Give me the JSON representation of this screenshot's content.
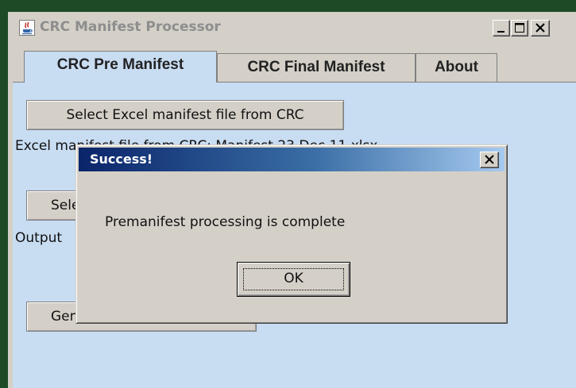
{
  "window": {
    "title": "CRC Manifest Processor",
    "controls": [
      "minimize-icon",
      "maximize-icon",
      "close-icon"
    ]
  },
  "tabs": [
    {
      "label": "CRC Pre Manifest",
      "selected": true
    },
    {
      "label": "CRC Final Manifest",
      "selected": false
    },
    {
      "label": "About",
      "selected": false
    }
  ],
  "panel": {
    "select_excel_label": "Select Excel manifest file from CRC",
    "excel_file_label": "Excel manifest file from CRC:  Manifest 23 Dec 11.xlsx",
    "select_output_label": "Sele",
    "output_label": "Output",
    "generate_label": "Gen"
  },
  "dialog": {
    "title": "Success!",
    "message": "Premanifest processing is complete",
    "ok_label": "OK"
  },
  "colors": {
    "frame": "#1e4b26",
    "panel_background": "#c8dcf2",
    "dialog_title_start": "#0a246a",
    "dialog_title_end": "#a6caf0"
  }
}
